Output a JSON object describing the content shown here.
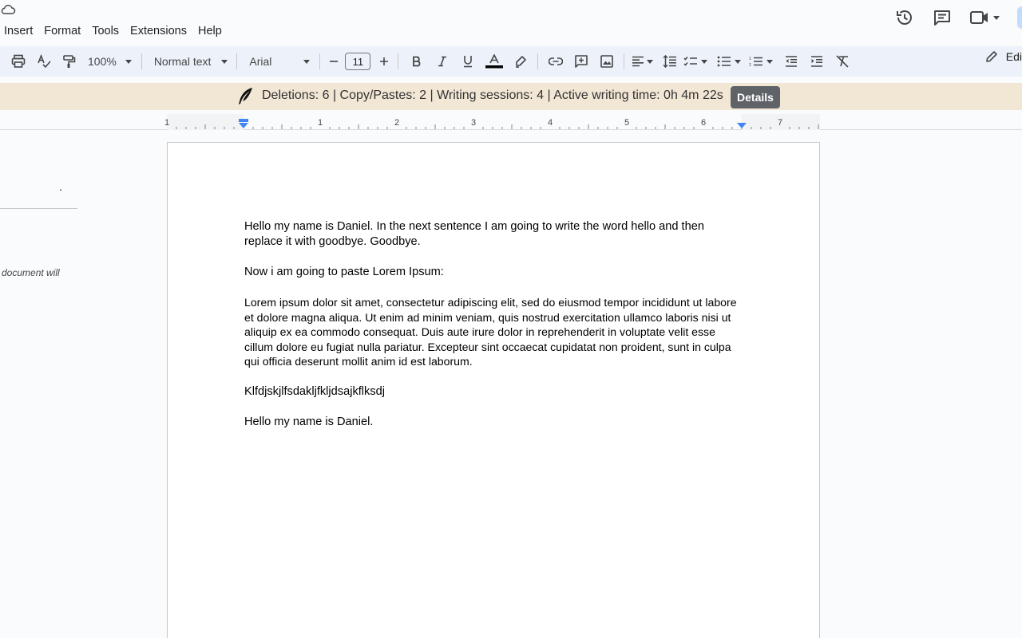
{
  "menu": [
    "Insert",
    "Format",
    "Tools",
    "Extensions",
    "Help"
  ],
  "toolbar": {
    "zoom": "100%",
    "style": "Normal text",
    "font": "Arial",
    "font_size": "11",
    "edit_label": "Edi"
  },
  "banner": {
    "text": "Deletions: 6 | Copy/Pastes: 2 | Writing sessions: 4 | Active writing time: 0h 4m 22s",
    "details_label": "Details"
  },
  "ruler": {
    "labels": [
      "1",
      "1",
      "2",
      "3",
      "4",
      "5",
      "6",
      "7"
    ]
  },
  "left_panel": {
    "dot": ".",
    "note": "document will"
  },
  "document": {
    "paragraphs": [
      "Hello my name is Daniel. In the next sentence I am going to write the word hello and then replace it with goodbye. Goodbye.",
      "Now i am going to paste Lorem Ipsum:",
      "Lorem ipsum dolor sit amet, consectetur adipiscing elit, sed do eiusmod tempor incididunt ut labore et dolore magna aliqua. Ut enim ad minim veniam, quis nostrud exercitation ullamco laboris nisi ut aliquip ex ea commodo consequat. Duis aute irure dolor in reprehenderit in voluptate velit esse cillum dolore eu fugiat nulla pariatur. Excepteur sint occaecat cupidatat non proident, sunt in culpa qui officia deserunt mollit anim id est laborum.",
      "Klfdjskjlfsdakljfkljdsajkflksdj",
      "Hello my name is Daniel."
    ]
  },
  "colors": {
    "banner_bg": "#f2e6d5",
    "toolbar_bg": "#edf2fa",
    "details_bg": "#5f6368",
    "indent_marker": "#4285f4"
  }
}
